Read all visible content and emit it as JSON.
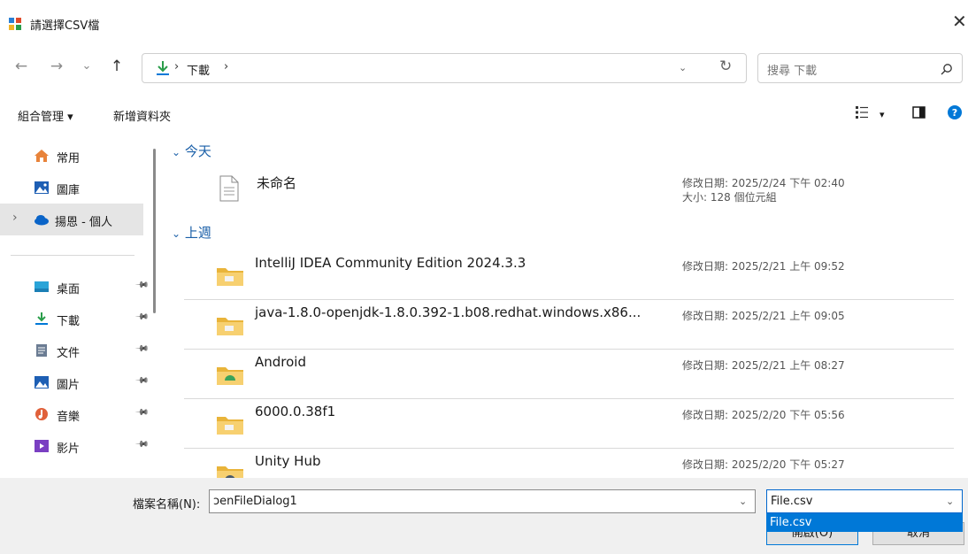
{
  "window": {
    "title": "請選擇CSV檔",
    "close_glyph": "✕"
  },
  "nav": {
    "back_glyph": "←",
    "forward_glyph": "→",
    "recent_glyph": "⌄",
    "up_glyph": "↑"
  },
  "address": {
    "crumbs": [
      "下載"
    ],
    "separator": "›",
    "dropdown_glyph": "⌄",
    "refresh_glyph": "↻"
  },
  "search": {
    "placeholder": "搜尋 下載"
  },
  "commands": {
    "organize_label": "組合管理 ▾",
    "new_folder_label": "新增資料夾",
    "view_menu_glyph": "▾"
  },
  "sidebar": {
    "items": [
      {
        "label": "常用",
        "icon": "home-icon"
      },
      {
        "label": "圖庫",
        "icon": "gallery-icon"
      },
      {
        "label": "揚恩 - 個人",
        "icon": "onedrive-cloud-icon",
        "selected": true,
        "expand_glyph": "›"
      },
      {
        "label": "桌面",
        "icon": "desktop-icon",
        "pinned": true
      },
      {
        "label": "下載",
        "icon": "download-icon",
        "pinned": true
      },
      {
        "label": "文件",
        "icon": "documents-icon",
        "pinned": true
      },
      {
        "label": "圖片",
        "icon": "pictures-icon",
        "pinned": true
      },
      {
        "label": "音樂",
        "icon": "music-icon",
        "pinned": true
      },
      {
        "label": "影片",
        "icon": "videos-icon",
        "pinned": true
      }
    ],
    "pin_glyph": "📌"
  },
  "content": {
    "groups": [
      {
        "header": "今天",
        "items": [
          {
            "name": "未命名",
            "icon": "file-icon",
            "date": "修改日期: 2025/2/24 下午 02:40",
            "size": "大小: 128 個位元組"
          }
        ]
      },
      {
        "header": "上週",
        "items": [
          {
            "name": "IntelliJ IDEA Community Edition 2024.3.3",
            "icon": "folder-icon",
            "date": "修改日期: 2025/2/21 上午 09:52"
          },
          {
            "name": "java-1.8.0-openjdk-1.8.0.392-1.b08.redhat.windows.x86...",
            "icon": "folder-icon",
            "date": "修改日期: 2025/2/21 上午 09:05"
          },
          {
            "name": "Android",
            "icon": "folder-icon",
            "date": "修改日期: 2025/2/21 上午 08:27"
          },
          {
            "name": "6000.0.38f1",
            "icon": "folder-icon",
            "date": "修改日期: 2025/2/20 下午 05:56"
          },
          {
            "name": "Unity Hub",
            "icon": "folder-icon",
            "date": "修改日期: 2025/2/20 下午 05:27"
          }
        ]
      }
    ],
    "group_chevron": "⌄"
  },
  "bottom": {
    "filename_label": "檔案名稱(N):",
    "filename_value": "ɔenFileDialog1",
    "filetype_value": "File.csv",
    "filetype_option": "File.csv",
    "open_button": "開啟(O)",
    "cancel_button": "取消",
    "dropdown_glyph": "⌄"
  },
  "colors": {
    "accent": "#0078d7",
    "group_header": "#1a5fa8",
    "folder_yellow": "#f5c44f"
  }
}
